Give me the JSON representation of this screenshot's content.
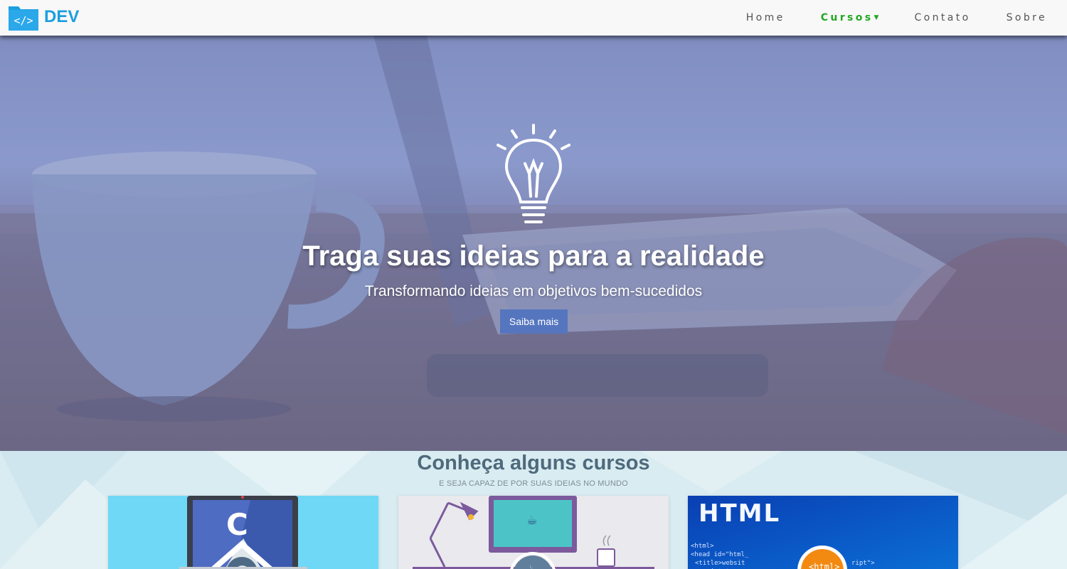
{
  "brand": {
    "name": "DEV",
    "logo_icon": "code-folder-icon",
    "color": "#1a9fe0"
  },
  "nav": {
    "items": [
      {
        "label": "Home",
        "active": false
      },
      {
        "label": "Cursos",
        "active": true,
        "has_dropdown": true
      },
      {
        "label": "Contato",
        "active": false
      },
      {
        "label": "Sobre",
        "active": false
      }
    ],
    "active_color": "#22a722"
  },
  "hero": {
    "icon": "lightbulb-icon",
    "title": "Traga suas ideias para a realidade",
    "subtitle": "Transformando ideias em objetivos bem-sucedidos",
    "button_label": "Saiba mais",
    "button_color": "#5575be"
  },
  "courses": {
    "title": "Conheça alguns cursos",
    "subtitle": "E SEJA CAPAZ DE POR SUAS IDEIAS NO MUNDO",
    "cards": [
      {
        "name": "c",
        "icon": "c-language-icon"
      },
      {
        "name": "java",
        "icon": "java-icon"
      },
      {
        "name": "html",
        "banner_text": "HTML",
        "icon": "html-icon"
      }
    ]
  }
}
